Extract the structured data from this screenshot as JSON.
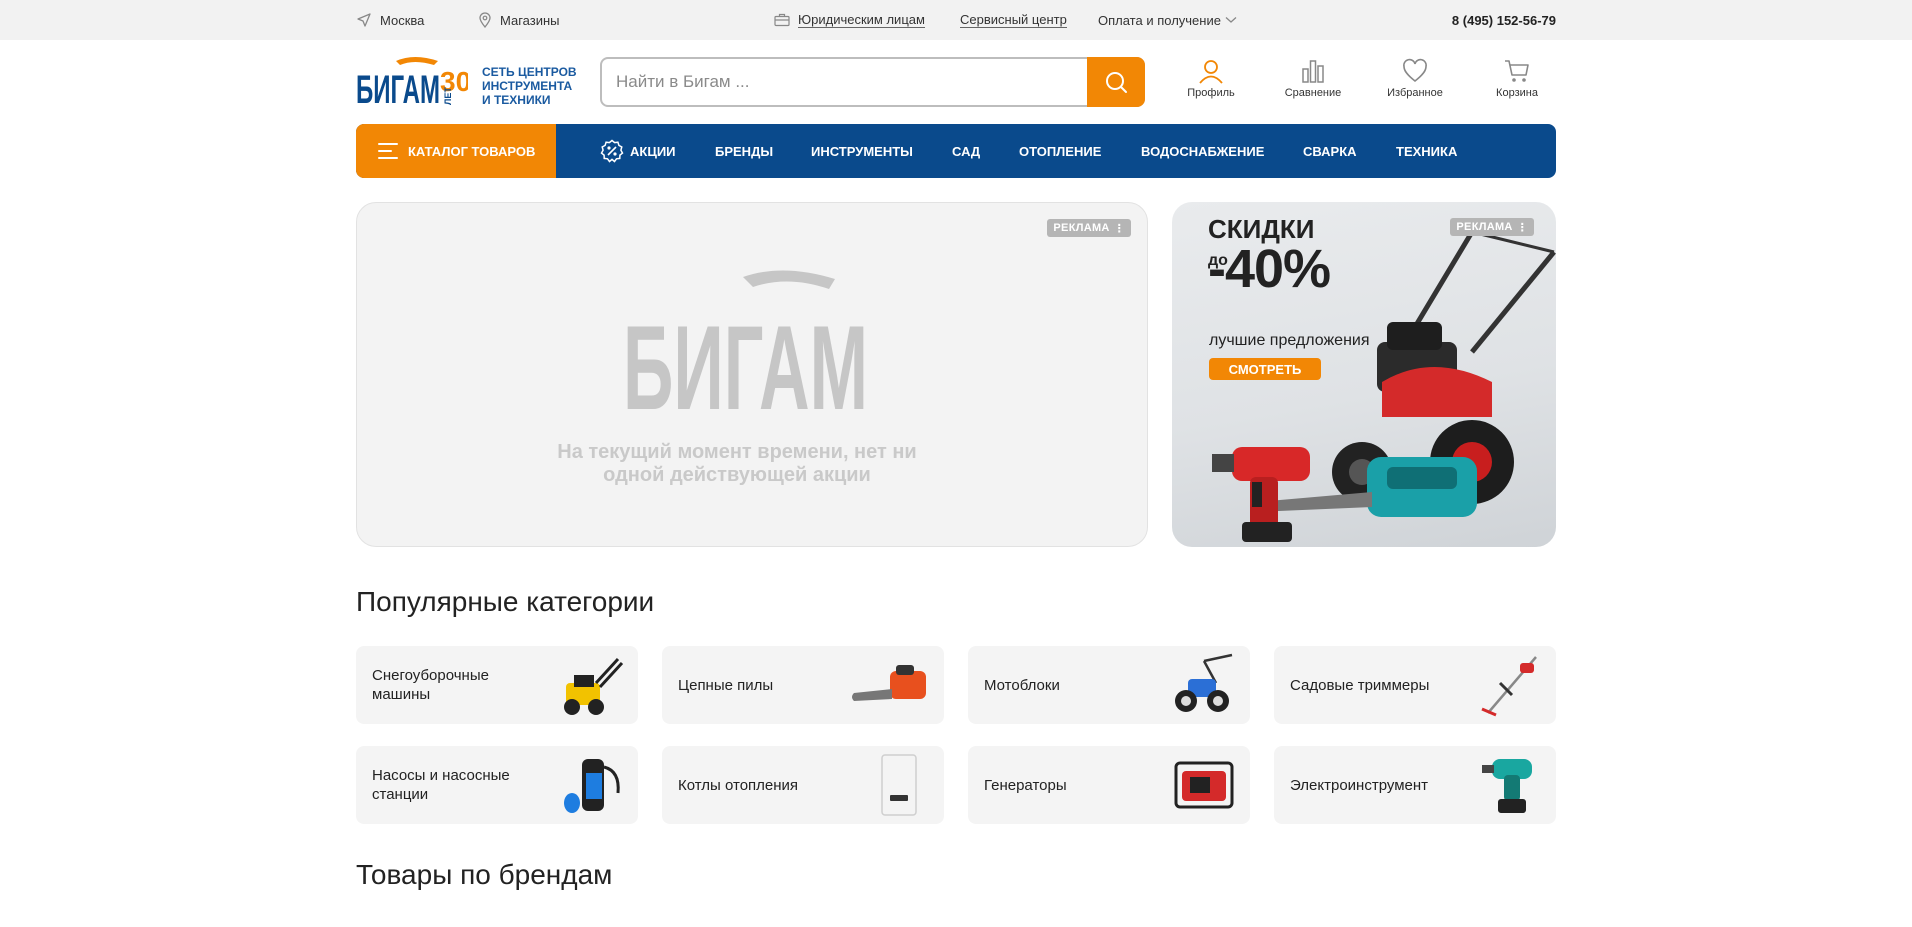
{
  "topbar": {
    "city": "Москва",
    "stores": "Магазины",
    "legal": "Юридическим лицам",
    "service": "Сервисный центр",
    "payment": "Оплата и получение",
    "phone": "8 (495) 152-56-79"
  },
  "header": {
    "logo_text": "БИГАМ",
    "logo_badge": "30 ЛЕТ",
    "tagline": [
      "СЕТЬ ЦЕНТРОВ",
      "ИНСТРУМЕНТА",
      "И ТЕХНИКИ"
    ],
    "search_placeholder": "Найти в Бигам ...",
    "icons": [
      {
        "label": "Профиль",
        "icon": "user-icon"
      },
      {
        "label": "Сравнение",
        "icon": "compare-icon"
      },
      {
        "label": "Избранное",
        "icon": "heart-icon"
      },
      {
        "label": "Корзина",
        "icon": "cart-icon"
      }
    ]
  },
  "nav": {
    "catalog": "КАТАЛОГ ТОВАРОВ",
    "items": [
      "АКЦИИ",
      "БРЕНДЫ",
      "ИНСТРУМЕНТЫ",
      "САД",
      "ОТОПЛЕНИЕ",
      "ВОДОСНАБЖЕНИЕ",
      "СВАРКА",
      "ТЕХНИКА"
    ]
  },
  "banner_main": {
    "badge": "РЕКЛАМА",
    "logo_text": "БИГАМ",
    "message": "На текущий момент времени, нет ни одной действующей акции"
  },
  "banner_side": {
    "badge": "РЕКЛАМА",
    "title": "СКИДКИ",
    "do": "до",
    "percent": "-40%",
    "subtitle": "лучшие предложения",
    "button": "СМОТРЕТЬ"
  },
  "categories": {
    "title": "Популярные категории",
    "items": [
      "Снегоуборочные машины",
      "Цепные пилы",
      "Мотоблоки",
      "Садовые триммеры",
      "Насосы и насосные станции",
      "Котлы отопления",
      "Генераторы",
      "Электроинструмент"
    ]
  },
  "brands": {
    "title": "Товары по брендам"
  },
  "colors": {
    "brand_orange": "#f28705",
    "brand_blue": "#0a4a8c"
  }
}
